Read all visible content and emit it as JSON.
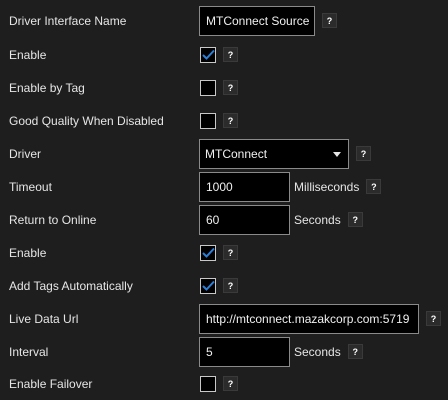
{
  "accent": "#2b7fd8",
  "help_text": "?",
  "rows": [
    {
      "label": "Driver Interface Name",
      "type": "text",
      "value": "MTConnect Source"
    },
    {
      "label": "Enable",
      "type": "checkbox",
      "checked": true
    },
    {
      "label": "Enable by Tag",
      "type": "checkbox",
      "checked": false
    },
    {
      "label": "Good Quality When Disabled",
      "type": "checkbox",
      "checked": false
    },
    {
      "label": "Driver",
      "type": "select",
      "value": "MTConnect"
    },
    {
      "label": "Timeout",
      "type": "text",
      "value": "1000",
      "unit": "Milliseconds"
    },
    {
      "label": "Return to Online",
      "type": "text",
      "value": "60",
      "unit": "Seconds"
    },
    {
      "label": "Enable",
      "type": "checkbox",
      "checked": true
    },
    {
      "label": "Add Tags Automatically",
      "type": "checkbox",
      "checked": true
    },
    {
      "label": "Live Data Url",
      "type": "text",
      "value": "http://mtconnect.mazakcorp.com:5719"
    },
    {
      "label": "Interval",
      "type": "text",
      "value": "5",
      "unit": "Seconds"
    },
    {
      "label": "Enable Failover",
      "type": "checkbox",
      "checked": false
    }
  ]
}
